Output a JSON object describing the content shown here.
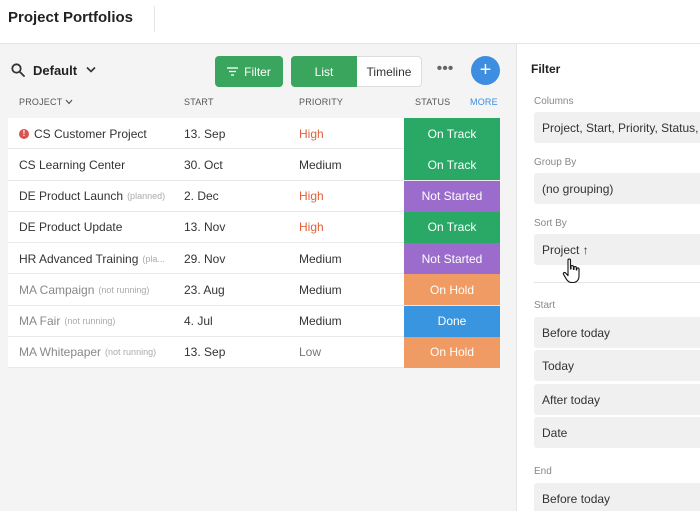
{
  "header": {
    "title": "Project Portfolios"
  },
  "toolbar": {
    "view_name": "Default",
    "filter_label": "Filter",
    "list_label": "List",
    "timeline_label": "Timeline",
    "more_label": "•••",
    "add_label": "+"
  },
  "table": {
    "columns": {
      "project": "PROJECT",
      "start": "START",
      "priority": "PRIORITY",
      "status": "STATUS",
      "more": "MORE"
    },
    "rows": [
      {
        "project": "CS Customer Project",
        "note": "",
        "warning": "!",
        "start": "13. Sep",
        "priority": "High",
        "status": "On Track"
      },
      {
        "project": "CS Learning Center",
        "note": "",
        "warning": "",
        "start": "30. Oct",
        "priority": "Medium",
        "status": "On Track"
      },
      {
        "project": "DE Product Launch",
        "note": "(planned)",
        "warning": "",
        "start": "2. Dec",
        "priority": "High",
        "status": "Not Started"
      },
      {
        "project": "DE Product Update",
        "note": "",
        "warning": "",
        "start": "13. Nov",
        "priority": "High",
        "status": "On Track"
      },
      {
        "project": "HR Advanced Training",
        "note": "(pla...",
        "warning": "",
        "start": "29. Nov",
        "priority": "Medium",
        "status": "Not Started"
      },
      {
        "project": "MA Campaign",
        "note": "(not running)",
        "warning": "",
        "start": "23. Aug",
        "priority": "Medium",
        "status": "On Hold"
      },
      {
        "project": "MA Fair",
        "note": "(not running)",
        "warning": "",
        "start": "4. Jul",
        "priority": "Medium",
        "status": "Done"
      },
      {
        "project": "MA Whitepaper",
        "note": "(not running)",
        "warning": "",
        "start": "13. Sep",
        "priority": "Low",
        "status": "On Hold"
      }
    ]
  },
  "status_colors": {
    "On Track": "#2aa866",
    "Not Started": "#9b6ccc",
    "On Hold": "#ef9b63",
    "Done": "#3a95e0"
  },
  "filter_panel": {
    "title": "Filter",
    "columns_label": "Columns",
    "columns_value": "Project, Start, Priority, Status,",
    "group_by_label": "Group By",
    "group_by_value": "(no grouping)",
    "sort_by_label": "Sort By",
    "sort_by_value": "Project ↑",
    "start_label": "Start",
    "start_options": [
      "Before today",
      "Today",
      "After today",
      "Date"
    ],
    "end_label": "End",
    "end_options": [
      "Before today"
    ]
  }
}
